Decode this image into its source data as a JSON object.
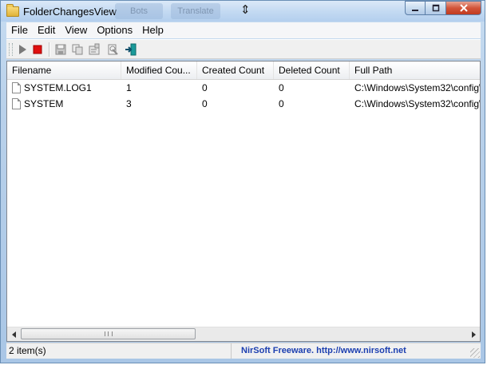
{
  "window": {
    "title": "FolderChangesView",
    "ghost_tabs": [
      "Bots",
      "Translate"
    ]
  },
  "menu": {
    "items": [
      "File",
      "Edit",
      "View",
      "Options",
      "Help"
    ]
  },
  "toolbar": {
    "icons": [
      "play-icon",
      "stop-icon",
      "save-icon",
      "copy-icon",
      "properties-icon",
      "html-report-icon",
      "exit-icon"
    ]
  },
  "table": {
    "columns": [
      "Filename",
      "Modified Cou...",
      "Created Count",
      "Deleted Count",
      "Full Path"
    ],
    "rows": [
      {
        "filename": "SYSTEM.LOG1",
        "modified": "1",
        "created": "0",
        "deleted": "0",
        "path": "C:\\Windows\\System32\\config\\"
      },
      {
        "filename": "SYSTEM",
        "modified": "3",
        "created": "0",
        "deleted": "0",
        "path": "C:\\Windows\\System32\\config\\"
      }
    ]
  },
  "status": {
    "count": "2 item(s)",
    "credit": "NirSoft Freeware.  http://www.nirsoft.net"
  },
  "colors": {
    "stop_red": "#e01010",
    "play_gray": "#7a7a7a",
    "credit_blue": "#1c3fb0",
    "exit_teal": "#1a9a9a"
  }
}
